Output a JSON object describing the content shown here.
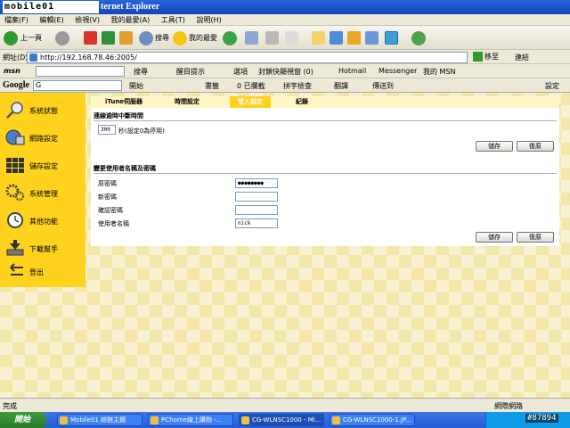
{
  "window": {
    "watermark_logo": "mobile01",
    "title": "ternet Explorer"
  },
  "menubar": [
    "檔案(F)",
    "編輯(E)",
    "檢視(V)",
    "我的最愛(A)",
    "工具(T)",
    "說明(H)"
  ],
  "toolbar": {
    "back_label": "上一頁",
    "search_label": "搜尋",
    "favorites_label": "我的最愛"
  },
  "addressbar": {
    "label": "網址(D)",
    "url": "http://192.168.78.46:2005/",
    "go_label": "移至",
    "links_label": "連結"
  },
  "msnbar": {
    "logo": "msn",
    "search_label": "搜尋",
    "highlight_label": "醒目提示",
    "options_label": "選項",
    "blocked_label": "封鎖快顯視窗 (0)",
    "hotmail_label": "Hotmail",
    "messenger_label": "Messenger",
    "mymsn_label": "我的 MSN"
  },
  "googlebar": {
    "logo": "Google",
    "input_value": "G",
    "start_label": "開始",
    "bookmarks_label": "書籤",
    "blocked_label": "0 已攔截",
    "spellcheck_label": "拼字檢查",
    "translate_label": "翻譯",
    "sendto_label": "傳送到",
    "settings_label": "設定"
  },
  "sidebar": [
    {
      "label": "系統狀態",
      "icon": "magnifier-icon"
    },
    {
      "label": "網路設定",
      "icon": "network-icon"
    },
    {
      "label": "儲存設定",
      "icon": "storage-grid-icon"
    },
    {
      "label": "系統管理",
      "icon": "gears-icon"
    },
    {
      "label": "其他功能",
      "icon": "clock-icon"
    },
    {
      "label": "下載幫手",
      "icon": "download-icon"
    },
    {
      "label": "登出",
      "icon": "logout-arrow-icon"
    }
  ],
  "tabs": [
    {
      "label": "iTune伺服器",
      "active": false
    },
    {
      "label": "時間設定",
      "active": false
    },
    {
      "label": "登入設定",
      "active": true
    },
    {
      "label": "紀錄",
      "active": false
    }
  ],
  "idle_section": {
    "title": "連線逾時中斷時間",
    "timeout_value": "300",
    "timeout_suffix": "秒(設定0為停用)",
    "save_label": "儲存",
    "reset_label": "復原"
  },
  "password_section": {
    "title": "變更使用者名稱及密碼",
    "fields": [
      {
        "label": "原密碼",
        "value": "●●●●●●●●"
      },
      {
        "label": "新密碼",
        "value": ""
      },
      {
        "label": "確認密碼",
        "value": ""
      },
      {
        "label": "使用者名稱",
        "value": "nick"
      }
    ],
    "save_label": "儲存",
    "reset_label": "復原"
  },
  "statusbar": {
    "status": "完成",
    "zone": "網際網路"
  },
  "taskbar": {
    "start_label": "開始",
    "tasks": [
      {
        "label": "Mobile01 綜館主題",
        "active": false
      },
      {
        "label": "PChome線上購物 -...",
        "active": false
      },
      {
        "label": "CG-WLNSC1000 - Mi...",
        "active": true
      },
      {
        "label": "CG-WLNSC1000-1.JP...",
        "active": false
      }
    ],
    "watermark": "#87894"
  },
  "colors": {
    "accent_yellow": "#ffd21d",
    "tab_bar": "#fff6c4",
    "xp_blue": "#245dd7"
  }
}
